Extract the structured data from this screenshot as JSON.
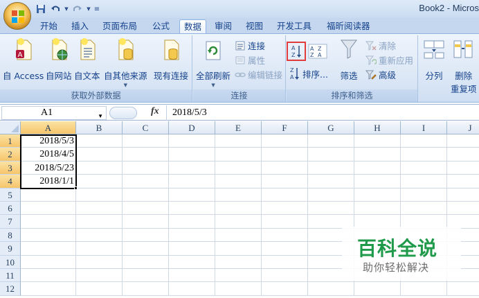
{
  "window": {
    "title": "Book2 - Micros"
  },
  "quick_access": {
    "save_icon": "save-icon",
    "undo_icon": "undo-icon",
    "redo_icon": "redo-icon",
    "customize_icon": "customize-qat-icon"
  },
  "tabs": [
    {
      "label": "开始",
      "active": false
    },
    {
      "label": "插入",
      "active": false
    },
    {
      "label": "页面布局",
      "active": false
    },
    {
      "label": "公式",
      "active": false
    },
    {
      "label": "数据",
      "active": true
    },
    {
      "label": "审阅",
      "active": false
    },
    {
      "label": "视图",
      "active": false
    },
    {
      "label": "开发工具",
      "active": false
    },
    {
      "label": "福昕阅读器",
      "active": false
    }
  ],
  "ribbon": {
    "get_external": {
      "group_label": "获取外部数据",
      "from_access": "自 Access",
      "from_web": "自网站",
      "from_text": "自文本",
      "from_other": "自其他来源",
      "existing": "现有连接"
    },
    "connections": {
      "group_label": "连接",
      "refresh_all": "全部刷新",
      "connections": "连接",
      "properties": "属性",
      "edit_links": "编辑链接"
    },
    "sort_filter": {
      "group_label": "排序和筛选",
      "sort": "排序...",
      "filter": "筛选",
      "clear": "清除",
      "reapply": "重新应用",
      "advanced": "高级"
    },
    "data_tools": {
      "text_to_columns": "分列",
      "remove_duplicates_line1": "删除",
      "remove_duplicates_line2": "重复项"
    }
  },
  "formula_bar": {
    "name_box": "A1",
    "fx_label": "fx",
    "formula": "2018/5/3"
  },
  "grid": {
    "columns": [
      "A",
      "B",
      "C",
      "D",
      "E",
      "F",
      "G",
      "H",
      "I",
      "J"
    ],
    "rows": [
      "1",
      "2",
      "3",
      "4",
      "5",
      "6",
      "7",
      "8",
      "9",
      "10",
      "11",
      "12"
    ],
    "cells_A": [
      "2018/5/3",
      "2018/4/5",
      "2018/5/23",
      "2018/1/1"
    ],
    "selected_column": "A",
    "selected_rows": [
      "1",
      "2",
      "3",
      "4"
    ]
  },
  "watermark": {
    "title": "百科全说",
    "subtitle": "助你轻松解决"
  },
  "colors": {
    "ribbon_bg": "#dde8f6",
    "tab_text": "#15428b",
    "selection_header": "#f7c56b",
    "highlight": "#e23b3b",
    "watermark_green": "#1e9a4a"
  }
}
